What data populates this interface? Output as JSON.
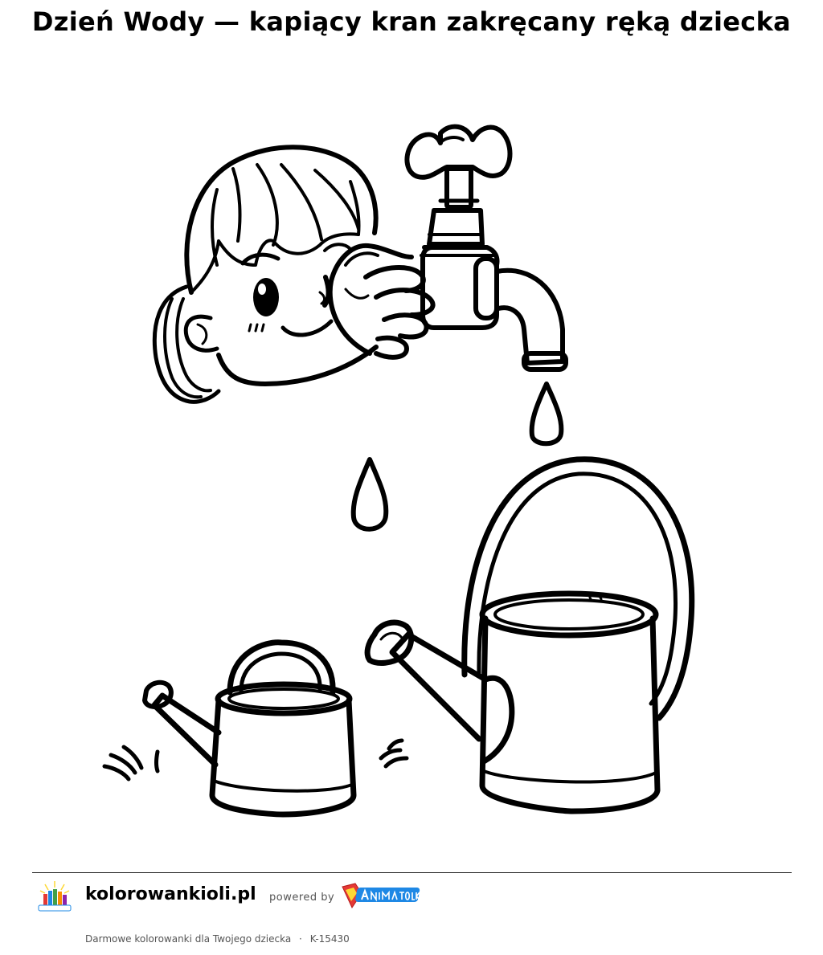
{
  "page": {
    "title": "Dzień Wody — kapiący kran zakręcany ręką dziecka"
  },
  "illustration": {
    "elements": [
      "child-head",
      "hand",
      "faucet",
      "water-drop",
      "water-drop",
      "large-watering-can",
      "small-watering-can"
    ]
  },
  "footer": {
    "site_name": "kolorowankioli.pl",
    "powered_by": "powered by",
    "partner_logo": "AnimatOlka",
    "tagline": "Darmowe kolorowanki dla Twojego dziecka",
    "separator": "·",
    "code": "K-15430"
  },
  "colors": {
    "ink": "#000000",
    "muted_text": "#555555",
    "logo_blue": "#1e88e5",
    "logo_red": "#e53935",
    "logo_yellow": "#fdd835"
  }
}
